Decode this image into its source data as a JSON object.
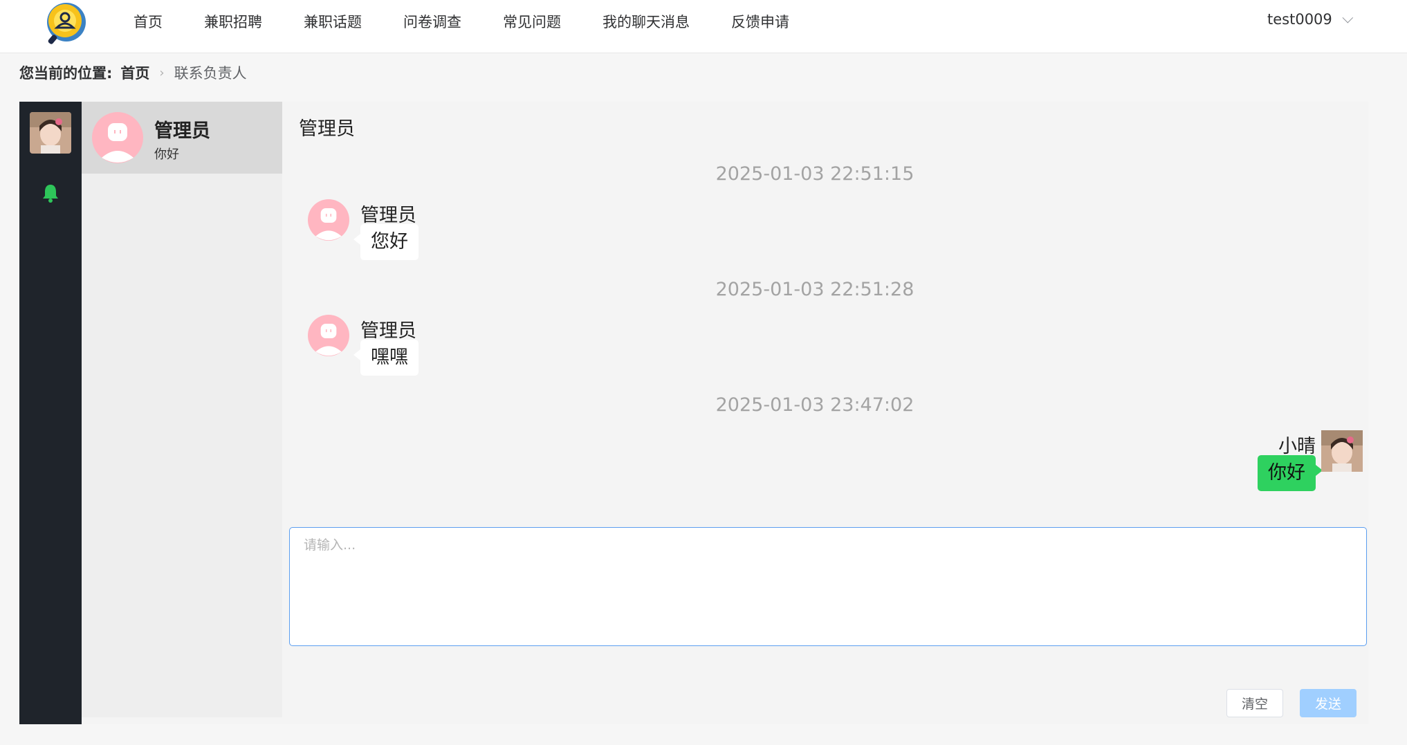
{
  "colors": {
    "accent": "#409eff",
    "rail": "#1f242b",
    "bell": "#2ec55a",
    "my_bubble": "#2ed15f",
    "avatar_pink": "#ffb6c1"
  },
  "header": {
    "logo_icon": "magnifier-user-logo-icon",
    "nav": [
      {
        "label": "首页"
      },
      {
        "label": "兼职招聘"
      },
      {
        "label": "兼职话题"
      },
      {
        "label": "问卷调查"
      },
      {
        "label": "常见问题"
      },
      {
        "label": "我的聊天消息"
      },
      {
        "label": "反馈申请"
      }
    ],
    "username": "test0009"
  },
  "breadcrumb": {
    "label": "您当前的位置:",
    "home": "首页",
    "current": "联系负责人"
  },
  "sidebar": {
    "bell_icon": "bell-icon"
  },
  "sessions": [
    {
      "name": "管理员",
      "last_message": "你好"
    }
  ],
  "chat": {
    "title": "管理员",
    "messages": [
      {
        "time": "2025-01-03 22:51:15",
        "sender": "管理员",
        "text": "您好",
        "mine": false
      },
      {
        "time": "2025-01-03 22:51:28",
        "sender": "管理员",
        "text": "嘿嘿",
        "mine": false
      },
      {
        "time": "2025-01-03 23:47:02",
        "sender": "小晴",
        "text": "你好",
        "mine": true
      }
    ]
  },
  "composer": {
    "placeholder": "请输入...",
    "clear_label": "清空",
    "send_label": "发送"
  }
}
